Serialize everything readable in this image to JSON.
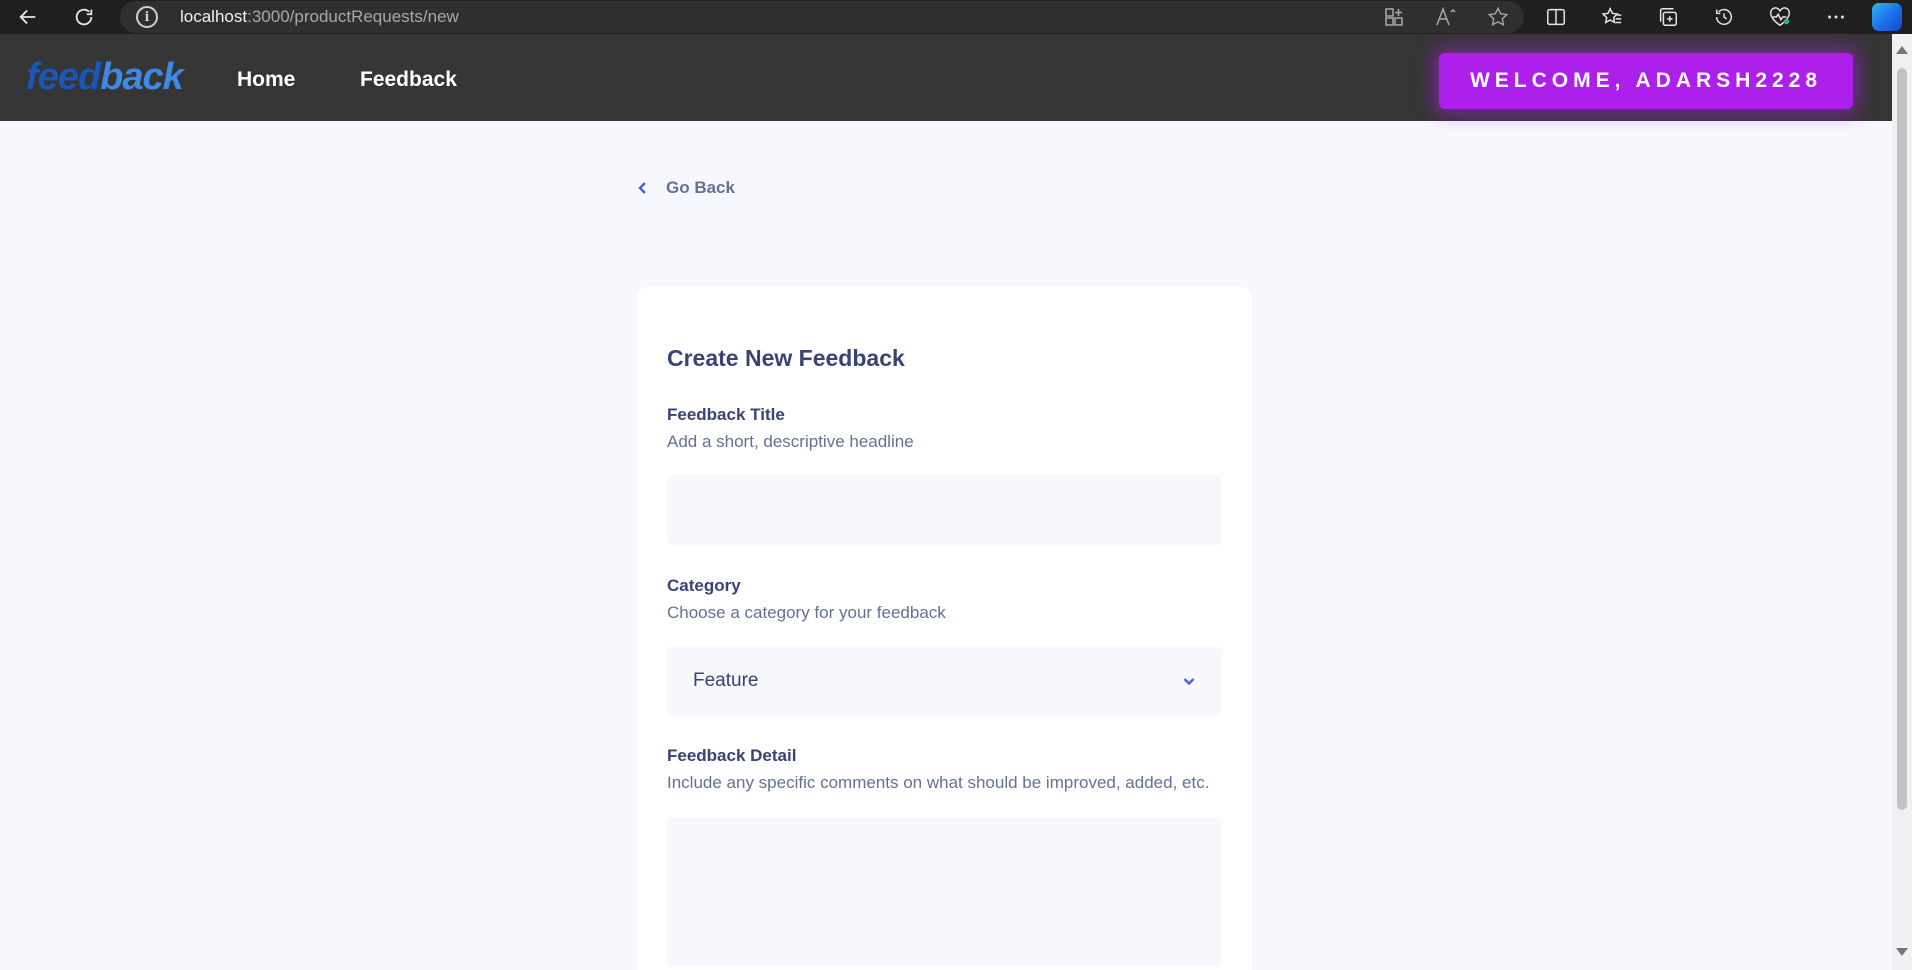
{
  "browser": {
    "url_host": "localhost",
    "url_path": ":3000/productRequests/new"
  },
  "header": {
    "logo_part1": "feed",
    "logo_part2": "back",
    "nav": [
      "Home",
      "Feedback"
    ],
    "welcome": "WELCOME, ADARSH2228"
  },
  "page": {
    "go_back": "Go Back",
    "title": "Create New Feedback",
    "fields": {
      "title": {
        "label": "Feedback Title",
        "description": "Add a short, descriptive headline",
        "value": ""
      },
      "category": {
        "label": "Category",
        "description": "Choose a category for your feedback",
        "value": "Feature"
      },
      "detail": {
        "label": "Feedback Detail",
        "description": "Include any specific comments on what should be improved, added, etc.",
        "value": ""
      }
    }
  },
  "colors": {
    "accent_purple": "#AD1FEA",
    "accent_blue": "#4661E6",
    "text_dark": "#3A4374",
    "text_muted": "#647196",
    "page_bg": "#F7F8FD"
  }
}
